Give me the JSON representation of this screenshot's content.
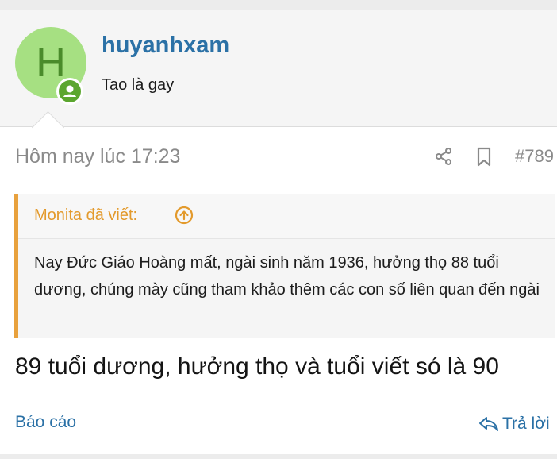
{
  "user": {
    "avatar_letter": "H",
    "name": "huyanhxam",
    "title": "Tao là gay"
  },
  "meta": {
    "date": "Hôm nay lúc 17:23",
    "post_number": "#789"
  },
  "quote": {
    "author": "Monita đã viết:",
    "text": "Nay Đức Giáo Hoàng mất, ngài sinh năm 1936, hưởng thọ 88 tuổi dương, chúng mày cũng tham khảo thêm các con số liên quan đến ngài"
  },
  "message": "89 tuổi dương, hưởng thọ và tuổi viết só là 90",
  "actions": {
    "report": "Báo cáo",
    "reply": "Trả lời"
  },
  "colors": {
    "link": "#2b71a6",
    "quote_accent": "#e8a13d",
    "avatar_bg": "#a6e082",
    "online": "#5ba62f"
  },
  "icons": [
    "share-icon",
    "bookmark-icon",
    "arrow-up-circle-icon",
    "reply-icon",
    "user-online-icon"
  ]
}
